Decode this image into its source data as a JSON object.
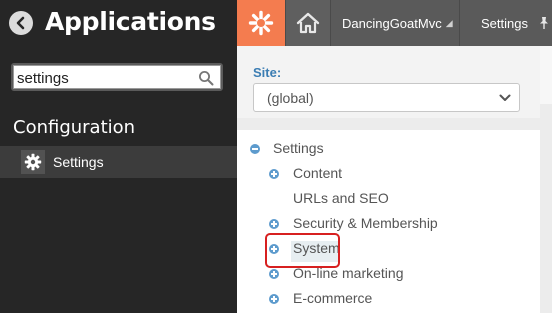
{
  "header": {
    "app_title": "Applications",
    "back_icon": "back-arrow-icon"
  },
  "search": {
    "value": "settings",
    "icon": "search-icon"
  },
  "sidebar": {
    "section": "Configuration",
    "items": [
      {
        "label": "Settings",
        "icon": "gear-icon",
        "selected": true
      }
    ]
  },
  "topbar": {
    "logo_icon": "kentico-logo-icon",
    "home_icon": "home-icon",
    "site": "DancingGoatMvc",
    "site_caret": "◢",
    "current_app": "Settings",
    "pin_icon": "pin-icon"
  },
  "site_selector": {
    "label": "Site:",
    "value": "(global)"
  },
  "tree": {
    "root": "Settings",
    "children": [
      {
        "label": "Content",
        "expandable": true
      },
      {
        "label": "URLs and SEO",
        "expandable": false
      },
      {
        "label": "Security & Membership",
        "expandable": true
      },
      {
        "label": "System",
        "expandable": true,
        "selected": true
      },
      {
        "label": "On-line marketing",
        "expandable": true
      },
      {
        "label": "E-commerce",
        "expandable": true
      }
    ]
  },
  "colors": {
    "sidebar_bg": "#262626",
    "topbar_bg": "#4a4a4a",
    "brand_orange": "#f47c4f",
    "toggle_blue": "#5d9bcd",
    "site_label_blue": "#3b7db3",
    "highlight_red": "#d72020"
  }
}
